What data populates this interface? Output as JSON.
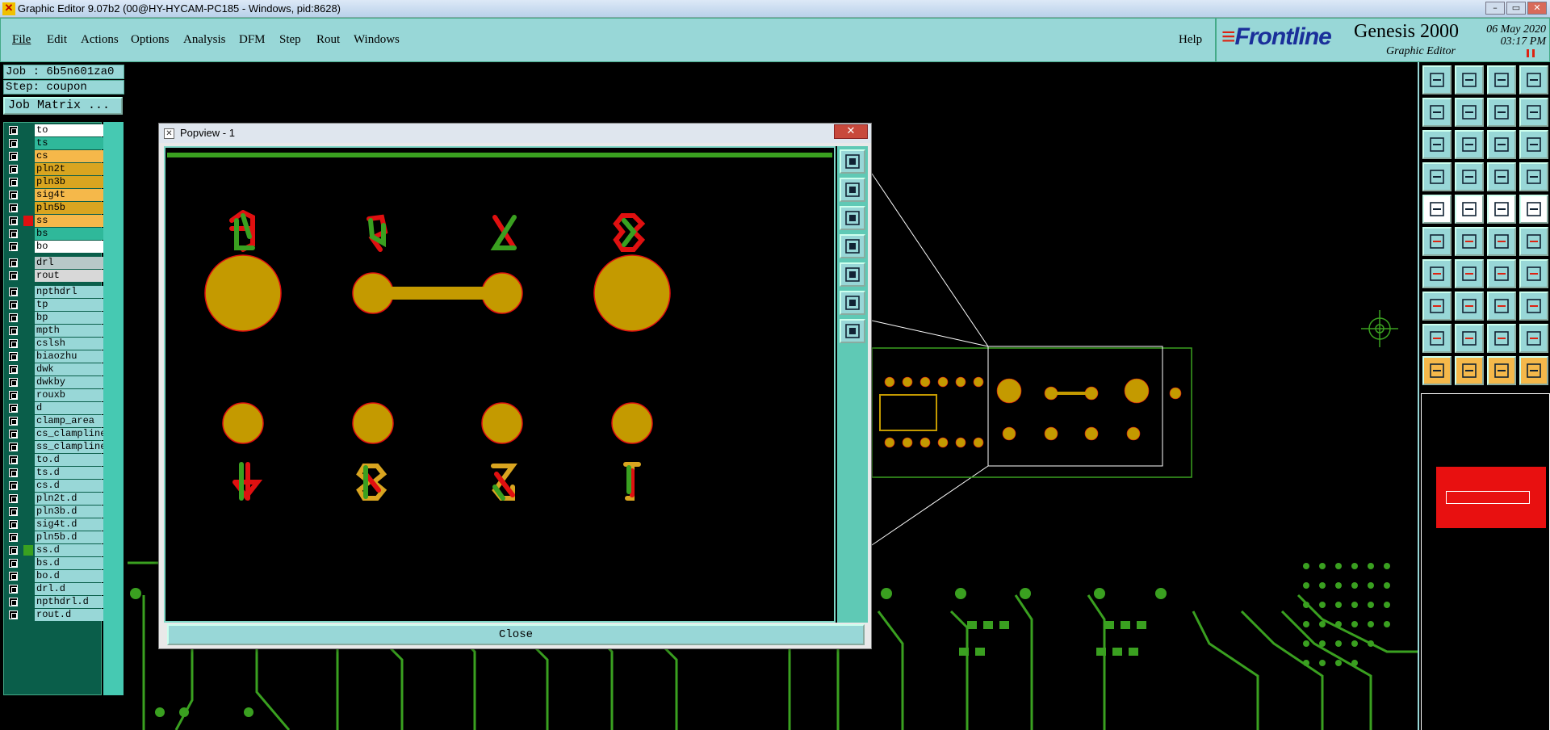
{
  "window": {
    "title": "Graphic Editor 9.07b2 (00@HY-HYCAM-PC185 - Windows, pid:8628)",
    "controls": [
      "–",
      "▭",
      "✕"
    ]
  },
  "menu": {
    "items": [
      "File",
      "Edit",
      "Actions",
      "Options",
      "Analysis",
      "DFM",
      "Step",
      "Rout",
      "Windows"
    ],
    "help": "Help"
  },
  "brand": {
    "logo": "Frontline",
    "product": "Genesis 2000",
    "subtitle": "Graphic Editor",
    "date": "06 May 2020",
    "time": "03:17 PM"
  },
  "job": {
    "job_line": "Job : 6b5n601za0",
    "step_line": "Step: coupon",
    "matrix_button": "Job Matrix ..."
  },
  "layers": [
    {
      "name": "to",
      "bg": "#ffffff",
      "mark": "#000000"
    },
    {
      "name": "ts",
      "bg": "#2fb89a",
      "mark": "#000000"
    },
    {
      "name": "cs",
      "bg": "#f5b84a",
      "mark": "#000000"
    },
    {
      "name": "pln2t",
      "bg": "#d9a520",
      "mark": "#000000"
    },
    {
      "name": "pln3b",
      "bg": "#d9a520",
      "mark": "#000000"
    },
    {
      "name": "sig4t",
      "bg": "#f5b84a",
      "mark": "#000000"
    },
    {
      "name": "pln5b",
      "bg": "#d9a520",
      "mark": "#000000"
    },
    {
      "name": "ss",
      "bg": "#f5b84a",
      "mark": "#e01010"
    },
    {
      "name": "bs",
      "bg": "#2fb89a",
      "mark": "#000000"
    },
    {
      "name": "bo",
      "bg": "#ffffff",
      "mark": "#000000"
    },
    {
      "name": "drl",
      "bg": "#b8c8c8",
      "mark": "#000000"
    },
    {
      "name": "rout",
      "bg": "#d8d8d8",
      "mark": "#000000"
    },
    {
      "name": "npthdrl",
      "bg": "#98d7d7",
      "mark": "#000000"
    },
    {
      "name": "tp",
      "bg": "#98d7d7",
      "mark": "#000000"
    },
    {
      "name": "bp",
      "bg": "#98d7d7",
      "mark": "#000000"
    },
    {
      "name": "mpth",
      "bg": "#98d7d7",
      "mark": "#000000"
    },
    {
      "name": "cslsh",
      "bg": "#98d7d7",
      "mark": "#000000"
    },
    {
      "name": "biaozhu",
      "bg": "#98d7d7",
      "mark": "#000000"
    },
    {
      "name": "dwk",
      "bg": "#98d7d7",
      "mark": "#000000"
    },
    {
      "name": "dwkby",
      "bg": "#98d7d7",
      "mark": "#000000"
    },
    {
      "name": "rouxb",
      "bg": "#98d7d7",
      "mark": "#000000"
    },
    {
      "name": "d",
      "bg": "#98d7d7",
      "mark": "#000000"
    },
    {
      "name": "clamp_area",
      "bg": "#98d7d7",
      "mark": "#000000"
    },
    {
      "name": "cs_clampline",
      "bg": "#98d7d7",
      "mark": "#000000"
    },
    {
      "name": "ss_clampline",
      "bg": "#98d7d7",
      "mark": "#000000"
    },
    {
      "name": "to.d",
      "bg": "#98d7d7",
      "mark": "#000000"
    },
    {
      "name": "ts.d",
      "bg": "#98d7d7",
      "mark": "#000000"
    },
    {
      "name": "cs.d",
      "bg": "#98d7d7",
      "mark": "#000000"
    },
    {
      "name": "pln2t.d",
      "bg": "#98d7d7",
      "mark": "#000000"
    },
    {
      "name": "pln3b.d",
      "bg": "#98d7d7",
      "mark": "#000000"
    },
    {
      "name": "sig4t.d",
      "bg": "#98d7d7",
      "mark": "#000000"
    },
    {
      "name": "pln5b.d",
      "bg": "#98d7d7",
      "mark": "#000000"
    },
    {
      "name": "ss.d",
      "bg": "#98d7d7",
      "mark": "#3aa020"
    },
    {
      "name": "bs.d",
      "bg": "#98d7d7",
      "mark": "#000000"
    },
    {
      "name": "bo.d",
      "bg": "#98d7d7",
      "mark": "#000000"
    },
    {
      "name": "drl.d",
      "bg": "#98d7d7",
      "mark": "#000000"
    },
    {
      "name": "npthdrl.d",
      "bg": "#98d7d7",
      "mark": "#000000"
    },
    {
      "name": "rout.d",
      "bg": "#98d7d7",
      "mark": "#000000"
    }
  ],
  "popview": {
    "title": "Popview - 1",
    "close_label": "Close"
  },
  "colors": {
    "pad": "#c49a00",
    "trace_green": "#3aa020",
    "trace_red": "#e01010",
    "panel_cyan": "#98d7d7",
    "overview_red": "#e81010"
  }
}
